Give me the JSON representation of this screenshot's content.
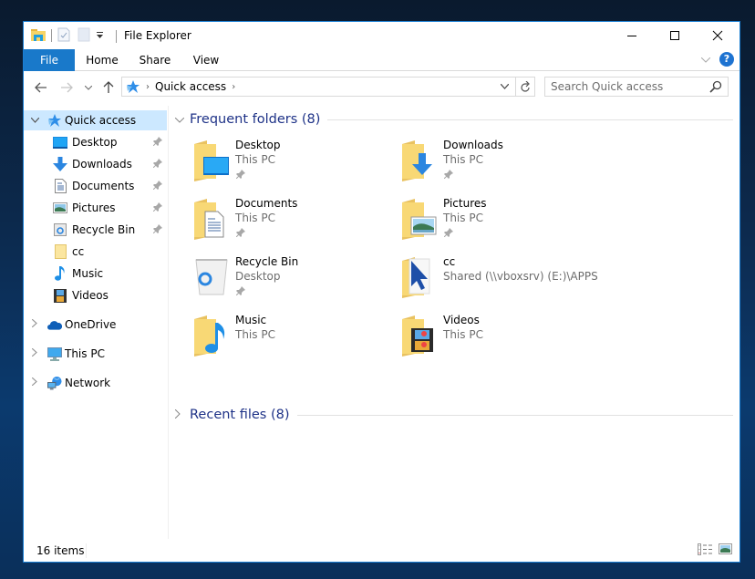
{
  "window": {
    "title": "File Explorer",
    "controls": {
      "minimize": "minimize",
      "maximize": "maximize",
      "close": "close"
    }
  },
  "quick_access_toolbar": {
    "icons": [
      "file-explorer-icon",
      "properties-icon",
      "new-folder-icon",
      "customize-dropdown-icon"
    ]
  },
  "ribbon": {
    "tabs": [
      {
        "label": "File",
        "active": true
      },
      {
        "label": "Home"
      },
      {
        "label": "Share"
      },
      {
        "label": "View"
      }
    ],
    "help_label": "?"
  },
  "navigation": {
    "address": {
      "root_icon": "quick-access-star-icon",
      "crumbs": [
        "Quick access"
      ]
    },
    "search": {
      "placeholder": "Search Quick access",
      "value": ""
    }
  },
  "nav_pane": {
    "quick_access": {
      "label": "Quick access",
      "expanded": true,
      "selected": true,
      "items": [
        {
          "label": "Desktop",
          "icon": "desktop-icon",
          "pinned": true
        },
        {
          "label": "Downloads",
          "icon": "downloads-icon",
          "pinned": true
        },
        {
          "label": "Documents",
          "icon": "documents-icon",
          "pinned": true
        },
        {
          "label": "Pictures",
          "icon": "pictures-icon",
          "pinned": true
        },
        {
          "label": "Recycle Bin",
          "icon": "recycle-bin-icon",
          "pinned": true
        },
        {
          "label": "cc",
          "icon": "folder-icon",
          "pinned": false
        },
        {
          "label": "Music",
          "icon": "music-icon",
          "pinned": false
        },
        {
          "label": "Videos",
          "icon": "videos-icon",
          "pinned": false
        }
      ]
    },
    "roots": [
      {
        "label": "OneDrive",
        "icon": "onedrive-icon"
      },
      {
        "label": "This PC",
        "icon": "this-pc-icon"
      },
      {
        "label": "Network",
        "icon": "network-icon"
      }
    ]
  },
  "content": {
    "frequent_folders": {
      "title": "Frequent folders (8)",
      "expanded": true,
      "items": [
        {
          "name": "Desktop",
          "location": "This PC",
          "pinned": true
        },
        {
          "name": "Downloads",
          "location": "This PC",
          "pinned": true
        },
        {
          "name": "Documents",
          "location": "This PC",
          "pinned": true
        },
        {
          "name": "Pictures",
          "location": "This PC",
          "pinned": true
        },
        {
          "name": "Recycle Bin",
          "location": "Desktop",
          "pinned": true
        },
        {
          "name": "cc",
          "location": "Shared (\\\\vboxsrv) (E:)\\APPS",
          "pinned": false
        },
        {
          "name": "Music",
          "location": "This PC",
          "pinned": false
        },
        {
          "name": "Videos",
          "location": "This PC",
          "pinned": false
        }
      ]
    },
    "recent_files": {
      "title": "Recent files (8)",
      "expanded": false
    }
  },
  "status_bar": {
    "item_count": "16 items",
    "views": [
      "details-view",
      "large-icons-view"
    ]
  },
  "colors": {
    "accent": "#1979ca",
    "selection": "#cce8ff",
    "group_header": "#1e3287",
    "secondary_text": "#6d6d6d",
    "folder": "#f5d77b"
  }
}
